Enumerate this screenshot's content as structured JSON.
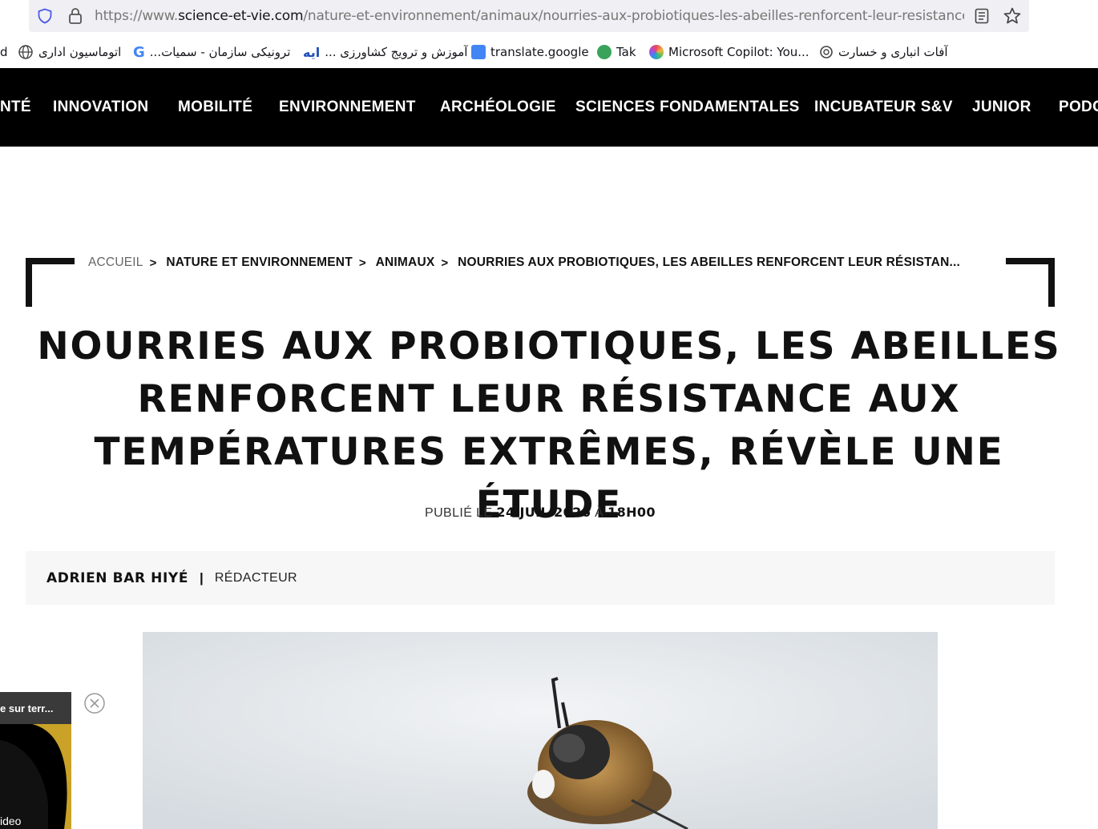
{
  "browser": {
    "url_prefix": "https://www.",
    "url_host": "science-et-vie.com",
    "url_path": "/nature-et-environnement/animaux/nourries-aux-probiotiques-les-abeilles-renforcent-leur-resistance-a",
    "icons": [
      "shield-icon",
      "lock-icon",
      "reader-view-icon",
      "bookmark-star-icon"
    ]
  },
  "bookmarks": [
    {
      "label": "d",
      "icon": "folder-icon"
    },
    {
      "label": "اتوماسیون اداری",
      "icon": "globe-icon"
    },
    {
      "label": "...ترونیکی سازمان - سمیات",
      "icon": "google-icon"
    },
    {
      "label": "... آموزش و ترویج کشاورزی",
      "icon": "ayeh-icon"
    },
    {
      "label": "translate.google",
      "icon": "translate-icon"
    },
    {
      "label": "Tak",
      "icon": "tak-icon"
    },
    {
      "label": "Microsoft Copilot: You...",
      "icon": "copilot-icon"
    },
    {
      "label": "آفات انباری و خسارت",
      "icon": "openai-icon"
    }
  ],
  "site_nav": {
    "items": [
      "NTÉ",
      "INNOVATION",
      "MOBILITÉ",
      "ENVIRONNEMENT",
      "ARCHÉOLOGIE",
      "SCIENCES FONDAMENTALES",
      "INCUBATEUR S&V",
      "JUNIOR",
      "PODC"
    ]
  },
  "breadcrumb": {
    "items": [
      "ACCUEIL",
      "NATURE ET ENVIRONNEMENT",
      "ANIMAUX",
      "NOURRIES AUX PROBIOTIQUES, LES ABEILLES RENFORCENT LEUR RÉSISTAN..."
    ],
    "separator": ">"
  },
  "article": {
    "title_lines": [
      "NOURRIES AUX PROBIOTIQUES, LES ABEILLES",
      "RENFORCENT LEUR RÉSISTANCE AUX",
      "TEMPÉRATURES EXTRÊMES, RÉVÈLE UNE ÉTUDE"
    ],
    "pub_prefix": "PUBLIÉ LE",
    "pub_date": "24 JUIL 2026",
    "pub_at": "À",
    "pub_time": "18H00",
    "author_name": "ADRIEN BAR HIYÉ",
    "author_sep": "|",
    "author_role": "RÉDACTEUR"
  },
  "video_popup": {
    "header": "e sur terr...",
    "footer": "ideo"
  },
  "colors": {
    "nav_bg": "#000000",
    "text": "#111111",
    "author_bg": "#f7f7f7",
    "url_bar_bg": "#f0f0f4"
  }
}
